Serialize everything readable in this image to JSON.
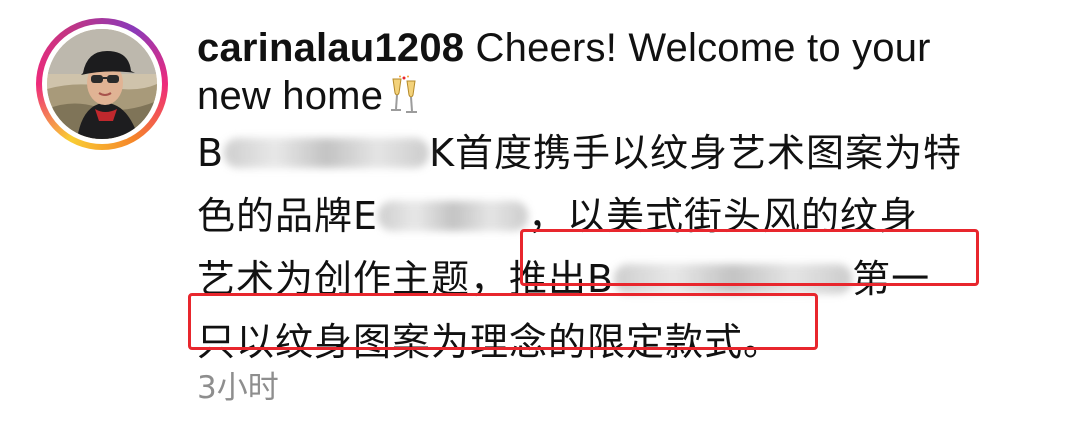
{
  "comment": {
    "username": "carinalau1208",
    "caption_line1": " Cheers! Welcome to your",
    "caption_line2": "new home",
    "emoji_icon": "clinking-glasses-icon",
    "body_lines": [
      {
        "prefix": "B",
        "suffix": "K首度携手以纹身艺术图案为特"
      },
      {
        "prefix": "色的品牌E",
        "suffix": "，以美式街头风的纹身"
      },
      {
        "prefix": "艺术为创作主题，",
        "highlight_prefix": "推出B",
        "suffix": "第一"
      },
      {
        "highlight_text": "只以纹身图案为理念的限定款式。"
      }
    ],
    "timestamp": "3小时"
  },
  "colors": {
    "highlight_border": "#e8262d",
    "timestamp": "#8e8e8e",
    "ring_start": "#f9ce34",
    "ring_mid": "#ee2a7b",
    "ring_end": "#8a3ab9"
  }
}
